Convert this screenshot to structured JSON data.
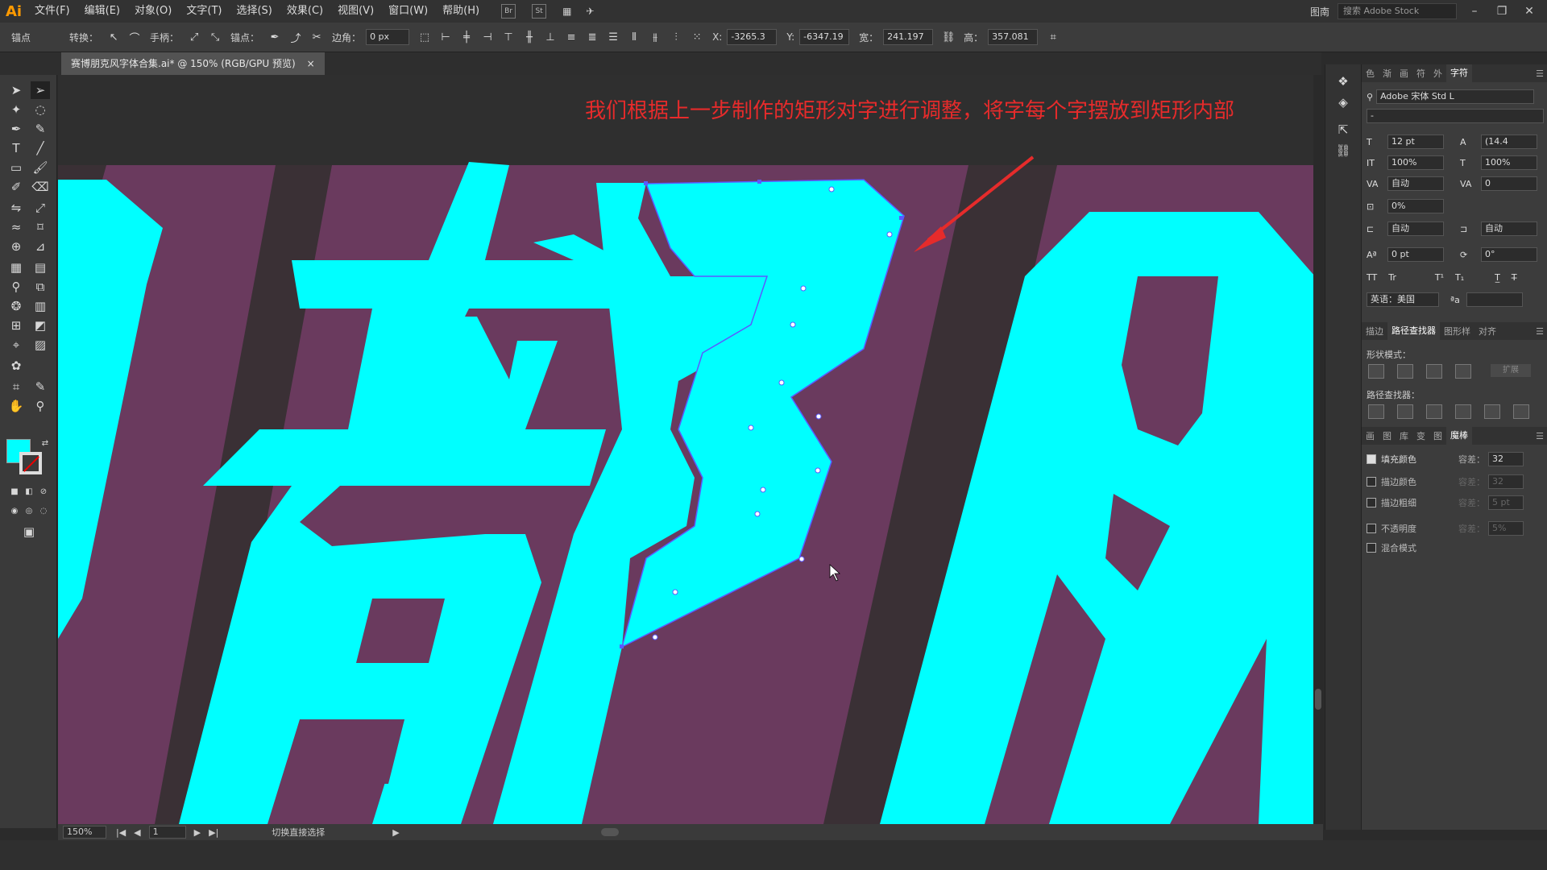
{
  "app": {
    "logo": "Ai"
  },
  "menu": [
    "文件(F)",
    "编辑(E)",
    "对象(O)",
    "文字(T)",
    "选择(S)",
    "效果(C)",
    "视图(V)",
    "窗口(W)",
    "帮助(H)"
  ],
  "menubar_right": {
    "workspace": "图南",
    "search_placeholder": "搜索 Adobe Stock"
  },
  "control": {
    "anchor_label": "锚点",
    "convert_label": "转换：",
    "handle_label": "手柄：",
    "anchors_label": "锚点：",
    "corner_label": "边角：",
    "corner_value": "0 px",
    "x_label": "X:",
    "x_value": "-3265.3",
    "y_label": "Y:",
    "y_value": "-6347.19",
    "w_label": "宽：",
    "w_value": "241.197",
    "h_label": "高：",
    "h_value": "357.081"
  },
  "document_tab": {
    "title": "赛博朋克风字体合集.ai* @ 150% (RGB/GPU 预览)",
    "close": "×"
  },
  "canvas": {
    "instruction": "我们根据上一步制作的矩形对字进行调整，将字每个字摆放到矩形内部",
    "colors": {
      "artboard": "#6a3a5e",
      "letters": "#00ffff",
      "stripe": "#3a3035",
      "arrow": "#e62b2b"
    }
  },
  "status": {
    "zoom": "150%",
    "page": "1",
    "tool_hint": "切换直接选择"
  },
  "char_panel": {
    "tabs": [
      "色",
      "渐",
      "画",
      "符",
      "外",
      "字符"
    ],
    "font_family": "Adobe 宋体 Std L",
    "font_style": "-",
    "size": "12 pt",
    "leading": "(14.4",
    "vscale": "100%",
    "hscale": "100%",
    "kerning": "自动",
    "tracking": "0",
    "tsume": "0%",
    "aki_left": "自动",
    "aki_right": "自动",
    "baseline": "0 pt",
    "rotation": "0°",
    "language": "英语：美国"
  },
  "pathfinder_panel": {
    "tabs": [
      "描边",
      "路径查找器",
      "图形样",
      "对齐"
    ],
    "shape_modes_label": "形状模式：",
    "expand_label": "扩展",
    "pathfinders_label": "路径查找器："
  },
  "magic_wand_panel": {
    "tabs": [
      "画",
      "图",
      "库",
      "变",
      "图",
      "魔棒"
    ],
    "fill_color": {
      "label": "填充颜色",
      "checked": true,
      "tol_label": "容差：",
      "tol_value": "32"
    },
    "stroke_color": {
      "label": "描边颜色",
      "checked": false,
      "tol_label": "容差：",
      "tol_value": "32"
    },
    "stroke_weight": {
      "label": "描边粗细",
      "checked": false,
      "tol_label": "容差：",
      "tol_value": "5 pt"
    },
    "opacity": {
      "label": "不透明度",
      "checked": false,
      "tol_label": "容差：",
      "tol_value": "5%"
    },
    "blend": {
      "label": "混合模式",
      "checked": false
    }
  }
}
